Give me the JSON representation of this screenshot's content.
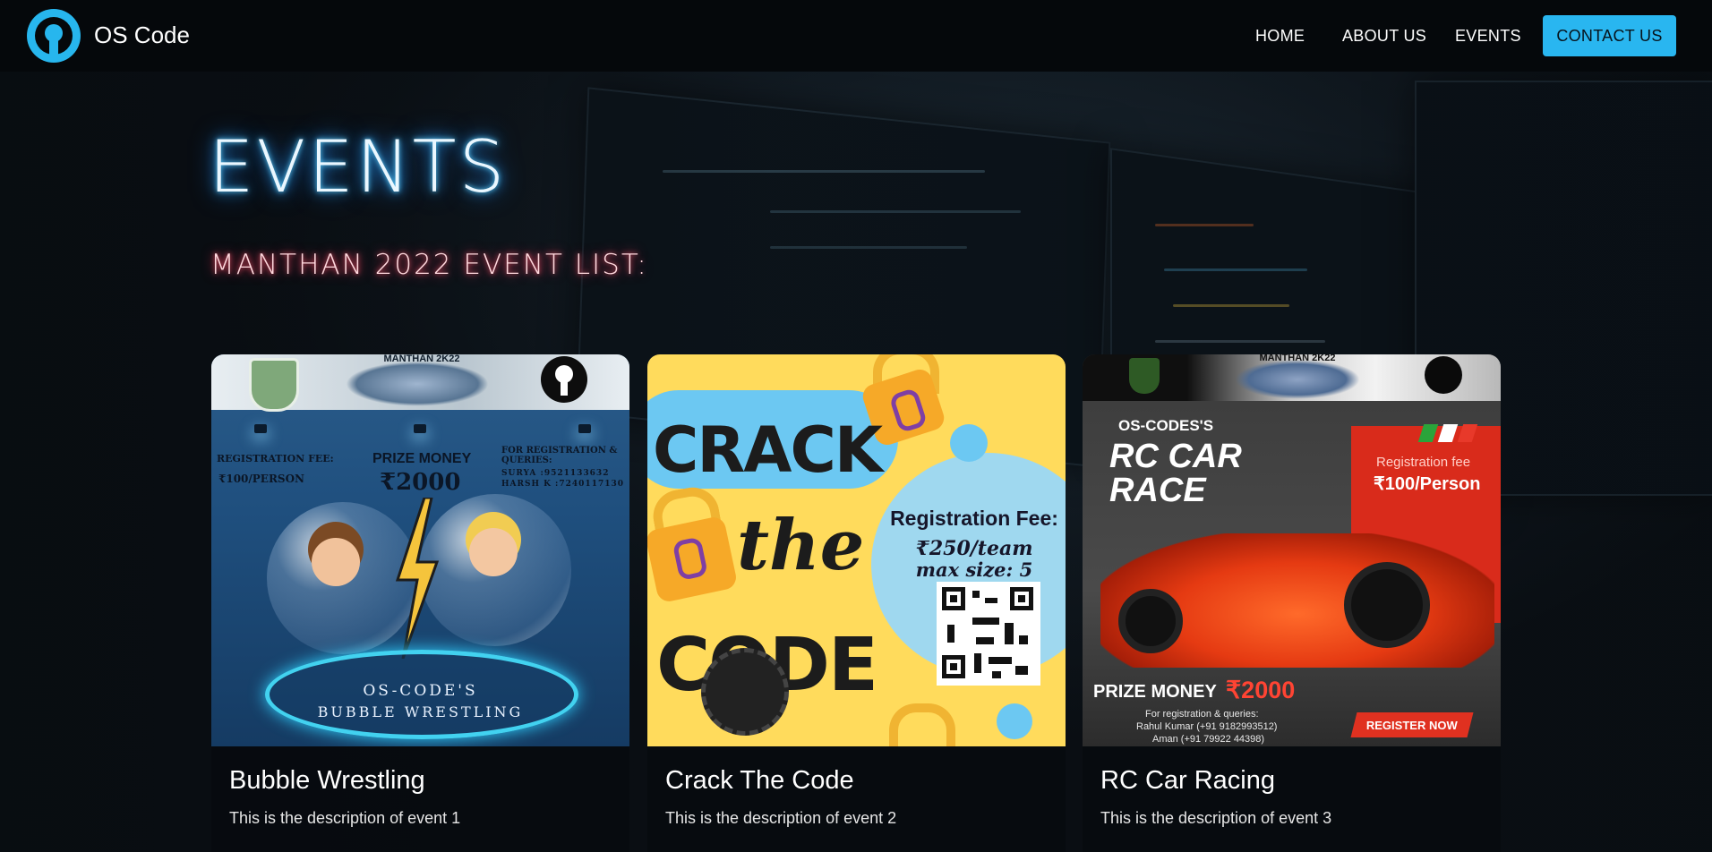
{
  "nav": {
    "brand": "OS Code",
    "links": [
      "HOME",
      "ABOUT US",
      "EVENTS"
    ],
    "cta": "CONTACT US"
  },
  "hero": {
    "title": "EVENTS",
    "subtitle": "MANTHAN 2022 EVENT LIST:"
  },
  "events": [
    {
      "title": "Bubble Wrestling",
      "description": "This is the description of event 1",
      "poster": {
        "header": "MANTHAN 2K22",
        "registration_label": "REGISTRATION FEE:",
        "registration_value": "₹100/PERSON",
        "prize_label": "PRIZE MONEY",
        "prize_value": "₹2000",
        "queries_label": "FOR REGISTRATION & QUERIES:",
        "contact_1": "SURYA :9521133632",
        "contact_2": "HARSH K :7240117130",
        "brand": "OS-CODE'S",
        "event": "BUBBLE WRESTLING"
      }
    },
    {
      "title": "Crack The Code",
      "description": "This is the description of event 2",
      "poster": {
        "word1": "CRACK",
        "word2": "the",
        "word3": "CODE",
        "fee_label": "Registration Fee:",
        "fee_value": "₹250/team",
        "team_size": "max size: 5"
      }
    },
    {
      "title": "RC Car Racing",
      "description": "This is the description of event 3",
      "poster": {
        "header": "MANTHAN 2K22",
        "brand": "OS-CODES'S",
        "line1": "RC CAR",
        "line2": "RACE",
        "fee_label": "Registration fee",
        "fee_value": "₹100/Person",
        "prize_label": "PRIZE MONEY",
        "prize_value": "₹2000",
        "queries": "For registration & queries:",
        "contact_1": "Rahul Kumar (+91 9182993512)",
        "contact_2": "Aman (+91 79922 44398)",
        "register": "REGISTER NOW"
      }
    }
  ],
  "colors": {
    "accent": "#29b6f0",
    "title_glow": "#2aa7ff",
    "subtitle_glow": "#ff2950"
  }
}
